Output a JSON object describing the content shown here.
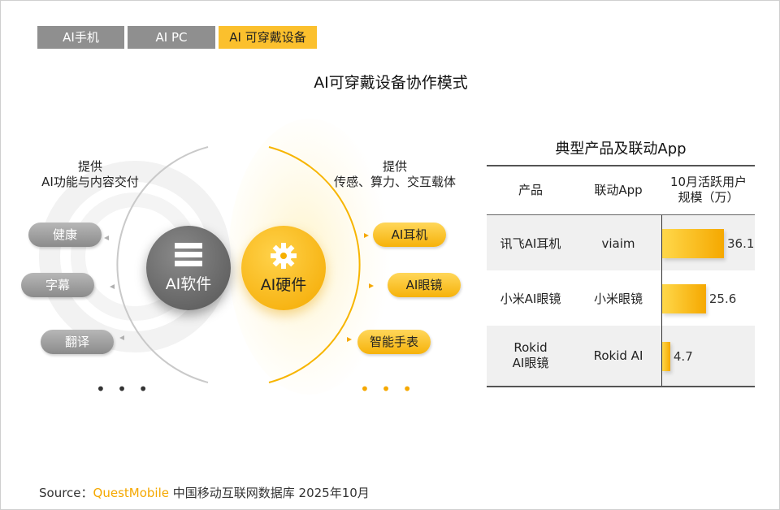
{
  "tabs": [
    {
      "label": "AI手机",
      "active": false
    },
    {
      "label": "AI PC",
      "active": false
    },
    {
      "label": "AI 可穿戴设备",
      "active": true
    }
  ],
  "title": "AI可穿戴设备协作模式",
  "software": {
    "provide_line1": "提供",
    "provide_line2": "AI功能与内容交付",
    "circle_label": "AI软件",
    "items": [
      "健康",
      "字幕",
      "翻译"
    ],
    "more": "• • •"
  },
  "hardware": {
    "provide_line1": "提供",
    "provide_line2": "传感、算力、交互载体",
    "circle_label": "AI硬件",
    "items": [
      "AI耳机",
      "AI眼镜",
      "智能手表"
    ],
    "more": "• • •"
  },
  "table": {
    "title": "典型产品及联动App",
    "headers": [
      "产品",
      "联动App",
      "10月活跃用户",
      "规模（万）"
    ],
    "rows": [
      {
        "product": "讯飞AI耳机",
        "product2": "",
        "app": "viaim",
        "value": 36.1,
        "value_label": "36.1"
      },
      {
        "product": "小米AI眼镜",
        "product2": "",
        "app": "小米眼镜",
        "value": 25.6,
        "value_label": "25.6"
      },
      {
        "product": "Rokid",
        "product2": "AI眼镜",
        "app": "Rokid AI",
        "value": 4.7,
        "value_label": "4.7"
      }
    ]
  },
  "chart_data": {
    "type": "bar",
    "categories": [
      "讯飞AI耳机",
      "小米AI眼镜",
      "Rokid AI眼镜"
    ],
    "values": [
      36.1,
      25.6,
      4.7
    ],
    "title": "",
    "ylabel": "10月活跃用户规模（万）"
  },
  "source": {
    "prefix": "Source：",
    "brand": "QuestMobile",
    "rest": " 中国移动互联网数据库 2025年10月"
  },
  "colors": {
    "accent": "#fbc02d",
    "gray": "#8f8f8f"
  }
}
